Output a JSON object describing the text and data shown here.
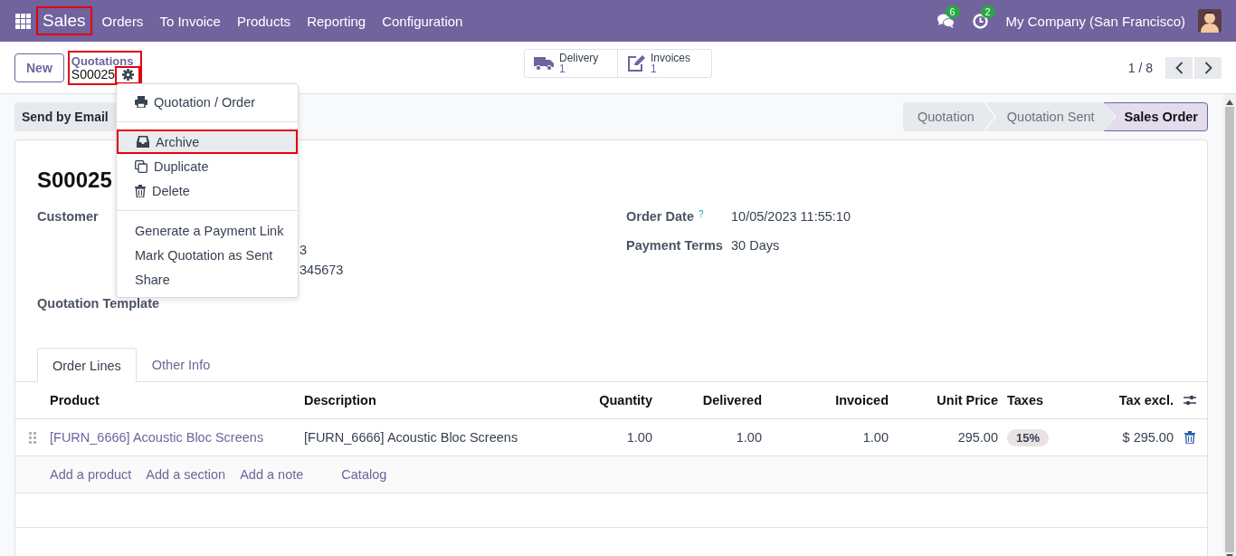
{
  "navbar": {
    "app": {
      "label": "Sales",
      "highlighted": true
    },
    "menu": [
      "Orders",
      "To Invoice",
      "Products",
      "Reporting",
      "Configuration"
    ],
    "messages_count": "6",
    "activities_count": "2",
    "company": "My Company (San Francisco)"
  },
  "control_panel": {
    "new_button": "New",
    "breadcrumb": {
      "parent": "Quotations",
      "current": "S00025",
      "highlighted": true
    },
    "gear_highlighted": true,
    "smart_buttons": [
      {
        "kind": "truck",
        "label": "Delivery",
        "count": "1"
      },
      {
        "kind": "edit",
        "label": "Invoices",
        "count": "1"
      }
    ],
    "pager": "1 / 8"
  },
  "action_menu": {
    "groups": [
      [
        {
          "kind": "print",
          "label": "Quotation / Order",
          "highlighted": false
        }
      ],
      [
        {
          "kind": "archive",
          "label": "Archive",
          "highlighted": true
        },
        {
          "kind": "copy",
          "label": "Duplicate",
          "highlighted": false
        },
        {
          "kind": "trash",
          "label": "Delete",
          "highlighted": false
        }
      ],
      [
        {
          "kind": "plain",
          "label": "Generate a Payment Link",
          "highlighted": false
        },
        {
          "kind": "plain",
          "label": "Mark Quotation as Sent",
          "highlighted": false
        },
        {
          "kind": "plain",
          "label": "Share",
          "highlighted": false
        }
      ]
    ]
  },
  "statusbar": {
    "send_button": "Send by Email",
    "stages": [
      {
        "label": "Quotation",
        "selected": false
      },
      {
        "label": "Quotation Sent",
        "selected": false
      },
      {
        "label": "Sales Order",
        "selected": true
      }
    ]
  },
  "form": {
    "title": "S00025",
    "customer_label": "Customer",
    "address_fragments": [
      "3",
      "345673"
    ],
    "template_label": "Quotation Template",
    "order_date": {
      "label": "Order Date",
      "help": "?",
      "value": "10/05/2023 11:55:10"
    },
    "payment_terms": {
      "label": "Payment Terms",
      "value": "30 Days"
    }
  },
  "notebook": {
    "tabs": [
      {
        "label": "Order Lines",
        "selected": true
      },
      {
        "label": "Other Info",
        "selected": false
      }
    ]
  },
  "order_lines": {
    "columns": [
      "Product",
      "Description",
      "Quantity",
      "Delivered",
      "Invoiced",
      "Unit Price",
      "Taxes",
      "Tax excl."
    ],
    "rows": [
      {
        "product": "[FURN_6666] Acoustic Bloc Screens",
        "description": "[FURN_6666] Acoustic Bloc Screens",
        "quantity": "1.00",
        "delivered": "1.00",
        "invoiced": "1.00",
        "unit_price": "295.00",
        "taxes": "15%",
        "subtotal": "$ 295.00"
      }
    ],
    "add_links": [
      "Add a product",
      "Add a section",
      "Add a note",
      "Catalog"
    ]
  }
}
